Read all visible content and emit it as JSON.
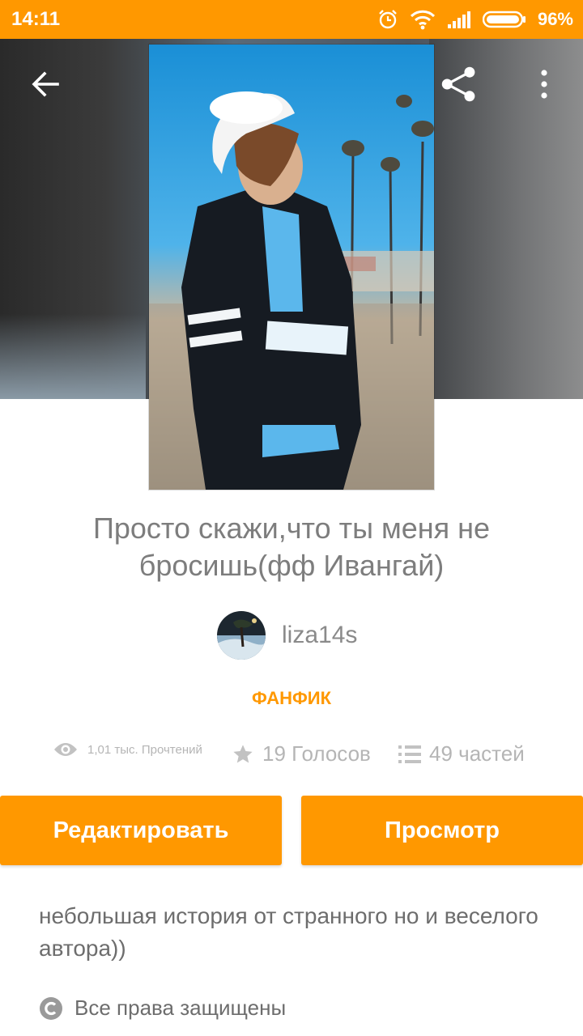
{
  "status_bar": {
    "time": "14:11",
    "battery": "96%"
  },
  "story": {
    "title_line1": "Просто скажи,что ты меня не",
    "title_line2": "бросишь(фф Ивангай)",
    "author": "liza14s",
    "category": "ФАНФИК",
    "reads": "1,01 тыс. Прочтений",
    "votes": "19 Голосов",
    "parts": "49 частей",
    "description": "небольшая история от странного но и веселого автора))",
    "rights": "Все права защищены"
  },
  "actions": {
    "edit_label": "Редактировать",
    "view_label": "Просмотр"
  },
  "icons": {
    "back": "arrow-left-icon",
    "share": "share-icon",
    "more": "more-vert-icon",
    "reads": "eye-icon",
    "votes": "star-icon",
    "parts": "list-icon",
    "rights": "copyright-icon"
  },
  "colors": {
    "accent": "#ff9800",
    "text": "#7d7d7d",
    "muted": "#b5b5b5"
  }
}
